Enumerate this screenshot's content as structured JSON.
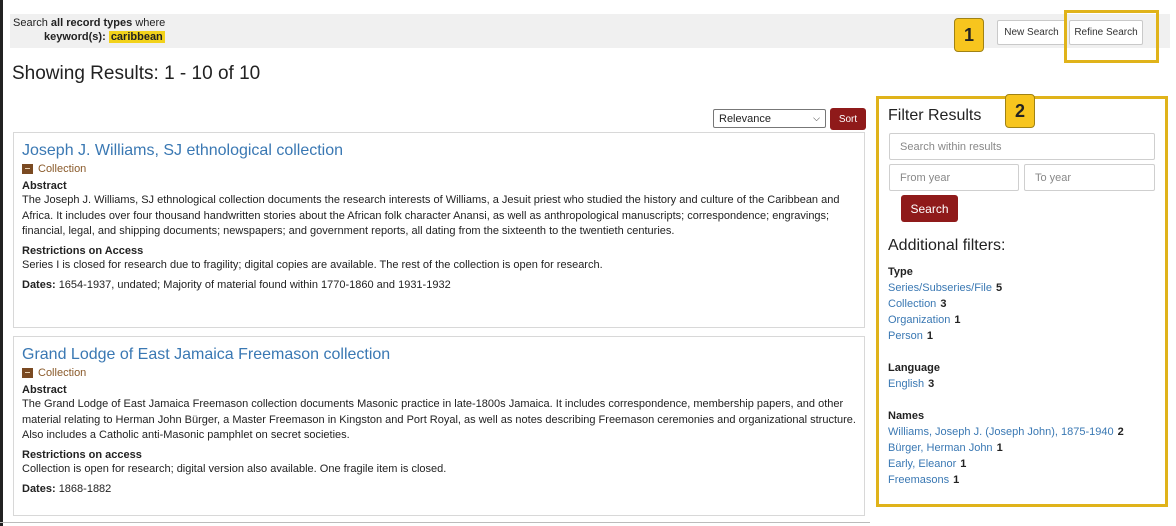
{
  "search_summary": {
    "prefix": "Search",
    "bold_part": "all record types",
    "suffix": "where",
    "field_label": "keyword(s):",
    "keyword": "caribbean"
  },
  "buttons": {
    "new_search": "New Search",
    "refine_search": "Refine Search",
    "sort": "Sort",
    "search": "Search"
  },
  "callouts": [
    "1",
    "2"
  ],
  "showing": "Showing Results: 1 - 10 of 10",
  "sort": {
    "selected": "Relevance"
  },
  "records": [
    {
      "title": "Joseph J. Williams, SJ ethnological collection",
      "type": "Collection",
      "abstract_label": "Abstract",
      "abstract": "The Joseph J. Williams, SJ ethnological collection documents the research interests of Williams, a Jesuit priest who studied the history and culture of the Caribbean and Africa. It includes over four thousand handwritten stories about the African folk character Anansi, as well as anthropological manuscripts; correspondence; engravings; financial, legal, and shipping documents; newspapers; and government reports, all dating from the sixteenth to the twentieth centuries.",
      "restrictions_label": "Restrictions on Access",
      "restrictions": "Series I is closed for research due to fragility; digital copies are available. The rest of the collection is open for research.",
      "dates_label": "Dates:",
      "dates": "1654-1937, undated; Majority of material found within 1770-1860 and 1931-1932"
    },
    {
      "title": "Grand Lodge of East Jamaica Freemason collection",
      "type": "Collection",
      "abstract_label": "Abstract",
      "abstract": "The Grand Lodge of East Jamaica Freemason collection documents Masonic practice in late-1800s Jamaica. It includes correspondence, membership papers, and other material relating to Herman John Bürger, a Master Freemason in Kingston and Port Royal, as well as notes describing Freemason ceremonies and organizational structure. Also includes a Catholic anti-Masonic pamphlet on secret societies.",
      "restrictions_label": "Restrictions on access",
      "restrictions": "Collection is open for research; digital version also available. One fragile item is closed.",
      "dates_label": "Dates:",
      "dates": "1868-1882"
    }
  ],
  "filters": {
    "title": "Filter Results",
    "search_placeholder": "Search within results",
    "from_placeholder": "From year",
    "to_placeholder": "To year",
    "additional": "Additional filters:",
    "groups": [
      {
        "heading": "Type",
        "items": [
          {
            "label": "Series/Subseries/File",
            "count": "5"
          },
          {
            "label": "Collection",
            "count": "3"
          },
          {
            "label": "Organization",
            "count": "1"
          },
          {
            "label": "Person",
            "count": "1"
          }
        ]
      },
      {
        "heading": "Language",
        "items": [
          {
            "label": "English",
            "count": "3"
          }
        ]
      },
      {
        "heading": "Names",
        "items": [
          {
            "label": "Williams, Joseph J. (Joseph John), 1875-1940",
            "count": "2"
          },
          {
            "label": "Bürger, Herman John",
            "count": "1"
          },
          {
            "label": "Early, Eleanor",
            "count": "1"
          },
          {
            "label": "Freemasons",
            "count": "1"
          }
        ]
      }
    ]
  },
  "colors": {
    "accent_red": "#8f1a1a",
    "link_blue": "#3a78b3",
    "highlight": "#f2d21b",
    "callout": "#f7c51e"
  }
}
